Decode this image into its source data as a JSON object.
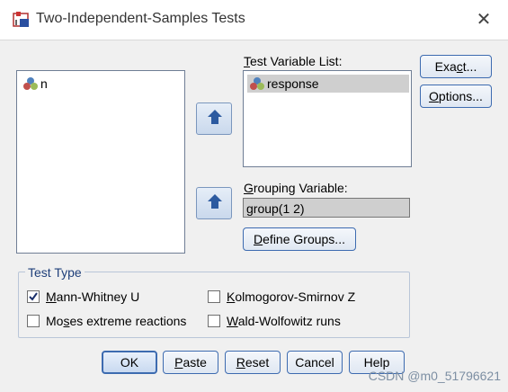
{
  "window": {
    "title": "Two-Independent-Samples Tests",
    "close_glyph": "✕"
  },
  "source_list": {
    "items": [
      {
        "label": "n",
        "icon": "nominal-variable-icon"
      }
    ]
  },
  "test_variable_list": {
    "label_prefix": "T",
    "label_rest": "est Variable List:",
    "items": [
      {
        "label": "response",
        "icon": "nominal-variable-icon"
      }
    ]
  },
  "grouping_variable": {
    "label_prefix": "G",
    "label_rest": "rouping Variable:",
    "value": "group(1 2)"
  },
  "buttons": {
    "exact": {
      "pre": "Exa",
      "ul": "c",
      "post": "t..."
    },
    "options": {
      "pre": "",
      "ul": "O",
      "post": "ptions..."
    },
    "define_groups": {
      "pre": "",
      "ul": "D",
      "post": "efine Groups..."
    },
    "ok": {
      "pre": "OK",
      "ul": "",
      "post": ""
    },
    "paste": {
      "pre": "",
      "ul": "P",
      "post": "aste"
    },
    "reset": {
      "pre": "",
      "ul": "R",
      "post": "eset"
    },
    "cancel": {
      "pre": "Cancel",
      "ul": "",
      "post": ""
    },
    "help": {
      "pre": "Help",
      "ul": "",
      "post": ""
    }
  },
  "test_type": {
    "title": "Test Type",
    "options": [
      {
        "pre": "",
        "ul": "M",
        "post": "ann-Whitney U",
        "checked": true
      },
      {
        "pre": "",
        "ul": "K",
        "post": "olmogorov-Smirnov Z",
        "checked": false
      },
      {
        "pre": "Mo",
        "ul": "s",
        "post": "es extreme reactions",
        "checked": false
      },
      {
        "pre": "",
        "ul": "W",
        "post": "ald-Wolfowitz runs",
        "checked": false
      }
    ]
  },
  "watermark": "CSDN @m0_51796621",
  "colors": {
    "accent": "#3d6bb0",
    "arrow": "#2c5aa0"
  }
}
